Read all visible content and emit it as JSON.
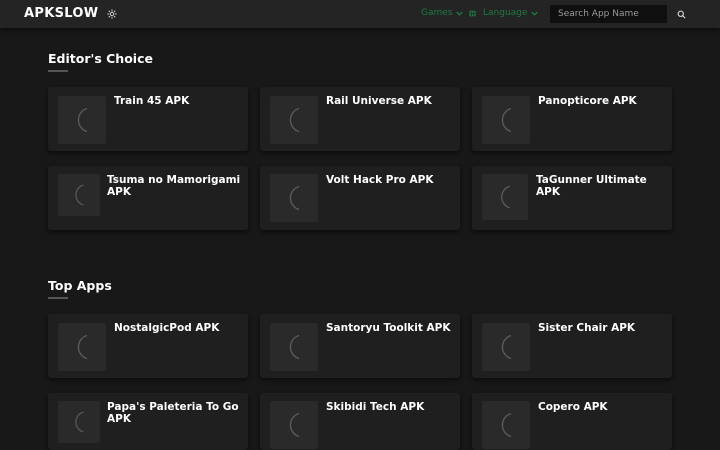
{
  "header": {
    "logo": "APKSLOW",
    "nav_games": "Games",
    "nav_language": "Language",
    "search_placeholder": "Search App Name",
    "accent_color": "#1d7a43"
  },
  "sections": [
    {
      "title": "Editor's Choice",
      "apps": [
        {
          "name": "Train 45 APK"
        },
        {
          "name": "Rail Universe APK"
        },
        {
          "name": "Panopticore APK"
        },
        {
          "name": "Tsuma no Mamorigami APK"
        },
        {
          "name": "Volt Hack Pro APK"
        },
        {
          "name": "TaGunner Ultimate APK"
        }
      ]
    },
    {
      "title": "Top Apps",
      "apps": [
        {
          "name": "NostalgicPod APK"
        },
        {
          "name": "Santoryu Toolkit APK"
        },
        {
          "name": "Sister Chair APK"
        },
        {
          "name": "Papa's Paleteria To Go APK"
        },
        {
          "name": "Skibidi Tech APK"
        },
        {
          "name": "Copero APK"
        }
      ]
    }
  ]
}
